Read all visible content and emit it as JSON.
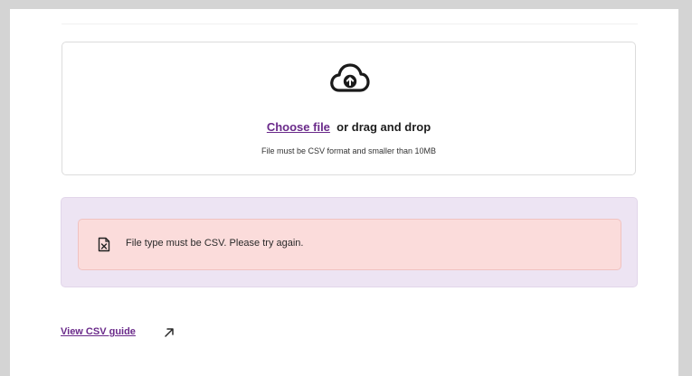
{
  "upload": {
    "choose_label": "Choose file",
    "drag_label": "or drag and drop",
    "hint": "File must be CSV format and smaller than 10MB",
    "icon": "cloud-upload-icon"
  },
  "error": {
    "message": "File type must be CSV. Please try again.",
    "icon": "file-x-icon"
  },
  "guide": {
    "label": "View CSV guide",
    "icon": "external-arrow-icon"
  },
  "colors": {
    "link": "#6a2a8a",
    "error_panel_bg": "#ede4f3",
    "error_alert_bg": "#fbdcdb",
    "frame": "#d4d4d4"
  }
}
